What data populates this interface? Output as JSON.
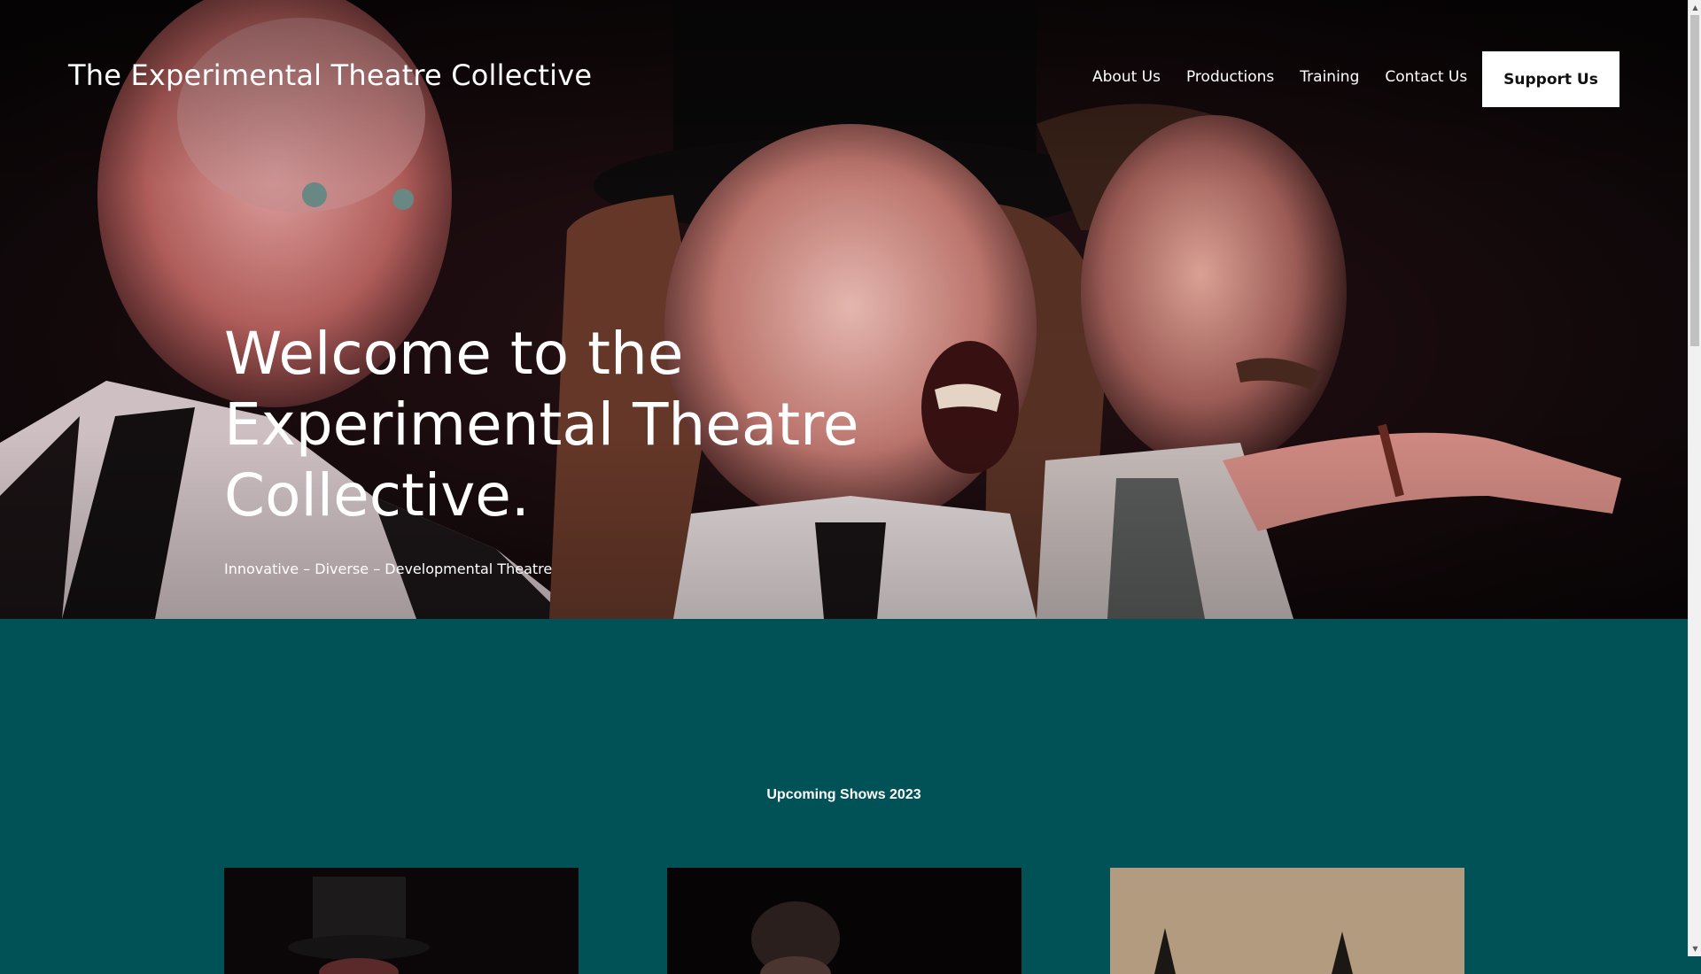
{
  "header": {
    "site_title": "The Experimental Theatre Collective",
    "nav": [
      {
        "label": "About Us"
      },
      {
        "label": "Productions"
      },
      {
        "label": "Training"
      },
      {
        "label": "Contact Us"
      }
    ],
    "cta_label": "Support Us"
  },
  "hero": {
    "heading_lines": [
      "Welcome to the",
      "Experimental Theatre",
      "Collective."
    ],
    "tagline": "Innovative – Diverse – Developmental Theatre"
  },
  "shows": {
    "heading": "Upcoming Shows 2023"
  },
  "colors": {
    "section_bg": "#005257",
    "text": "#ffffff",
    "cta_bg": "#ffffff",
    "cta_text": "#111111"
  },
  "scrollbar": {
    "up_arrow": "▲",
    "down_arrow": "▼"
  }
}
